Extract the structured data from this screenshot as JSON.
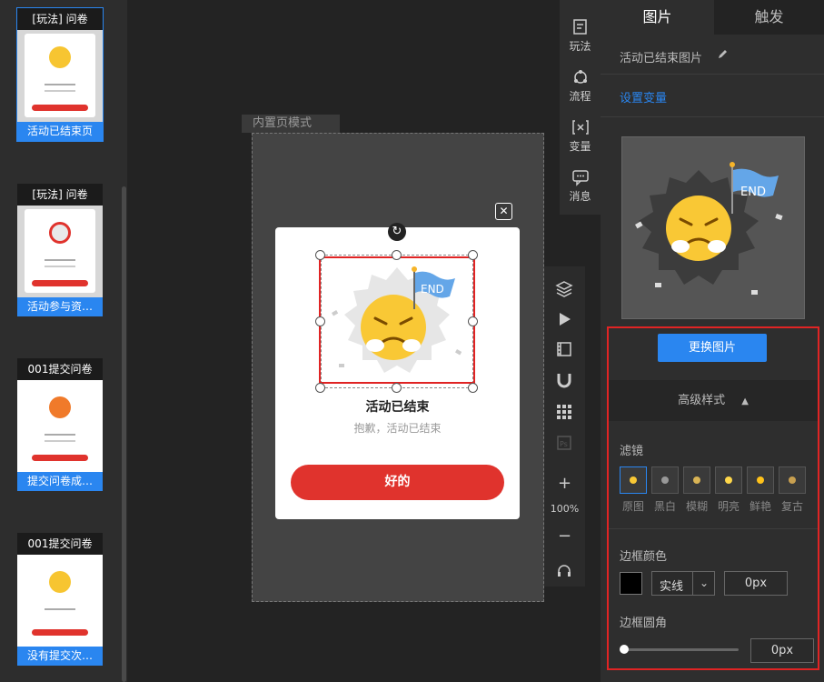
{
  "pages": [
    {
      "title": "[玩法] 问卷",
      "label": "活动已结束页",
      "selected": true
    },
    {
      "title": "[玩法] 问卷",
      "label": "活动参与资…",
      "selected": false
    },
    {
      "title": "001提交问卷",
      "label": "提交问卷成…",
      "selected": false
    },
    {
      "title": "001提交问卷",
      "label": "没有提交次…",
      "selected": false
    }
  ],
  "canvas": {
    "mode_tab": "内置页模式",
    "popup_title": "活动已结束",
    "popup_subtitle": "抱歉，活动已结束",
    "ok_button": "好的",
    "close_glyph": "✕",
    "rotate_glyph": "↻",
    "flag_text": "END"
  },
  "toolbar": {
    "items": [
      {
        "label": "玩法",
        "icon": "play-rule-icon"
      },
      {
        "label": "流程",
        "icon": "flow-icon"
      },
      {
        "label": "变量",
        "icon": "variable-icon"
      },
      {
        "label": "消息",
        "icon": "message-icon"
      }
    ],
    "zoom": "100%",
    "zoom_in": "+",
    "zoom_out": "−"
  },
  "panel": {
    "tabs": [
      "图片",
      "触发"
    ],
    "element_name": "活动已结束图片",
    "set_variable": "设置变量",
    "replace_image": "更换图片",
    "advanced_style": "高级样式",
    "filter_label": "滤镜",
    "filters": [
      "原图",
      "黑白",
      "模糊",
      "明亮",
      "鲜艳",
      "复古"
    ],
    "border_color_label": "边框颜色",
    "border_style": "实线",
    "border_width": "0px",
    "border_radius_label": "边框圆角",
    "border_radius_value": "0px",
    "colors": {
      "accent": "#2a86f0",
      "danger": "#e0332d",
      "border_color": "#000000"
    }
  }
}
